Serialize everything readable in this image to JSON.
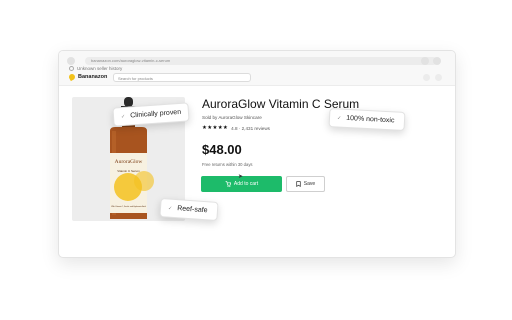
{
  "browser": {
    "url": "bananazon.com/auroraglow-vitamin-c-serum",
    "tab_label": "Unknown seller history"
  },
  "site": {
    "logo": "Bananazon",
    "search_placeholder": "Search for products"
  },
  "product": {
    "title": "AuroraGlow Vitamin C Serum",
    "seller": "Sold by AuroraGlow Skincare",
    "stars": "★★★★★",
    "rating_text": "4.8 · 2,431 reviews",
    "price": "$48.00",
    "returns": "Free returns within 30 days",
    "image_brand": "AuroraGlow",
    "image_line": "Vitamin C Serum",
    "image_small": "With Vitamin C, Ferulic and Hyaluronic Acid"
  },
  "actions": {
    "add_to_cart": "Add to cart",
    "save": "Save"
  },
  "badges": {
    "clinically_proven": "Clinically proven",
    "non_toxic": "100% non-toxic",
    "reef_safe": "Reef-safe"
  },
  "colors": {
    "accent": "#1dbb6a",
    "bottle_amber": "#a8541f",
    "label_yellow": "#f4c21f"
  }
}
